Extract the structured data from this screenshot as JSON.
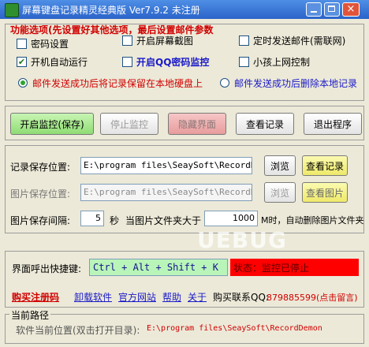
{
  "window": {
    "title": "屏幕键盘记录精灵经典版   Ver7.9.2   未注册",
    "min_glyph": "0",
    "max_glyph": "1",
    "close_glyph": "r"
  },
  "options": {
    "heading": "功能选项(先设置好其他选项，最后设置邮件参数",
    "password_settings": "密码设置",
    "screen_capture": "开启屏幕截图",
    "timed_email": "定时发送邮件(需联网)",
    "autostart": "开机自动运行",
    "qq_monitor": "开启QQ密码监控",
    "kid_control": "小孩上网控制",
    "keep_local": "邮件发送成功后将记录保留在本地硬盘上",
    "delete_local": "邮件发送成功后删除本地记录",
    "check_mark": "✔"
  },
  "actions": {
    "start": "开启监控(保存)",
    "stop": "停止监控",
    "hide": "隐藏界面",
    "view": "查看记录",
    "exit": "退出程序"
  },
  "paths": {
    "record_label": "记录保存位置:",
    "record_path": "E:\\program files\\SeaySoft\\RecordDemon",
    "browse1": "浏览",
    "view_records": "查看记录",
    "image_label": "图片保存位置:",
    "image_path": "E:\\program files\\SeaySoft\\RecordDemon",
    "browse2": "浏览",
    "view_images": "查看图片",
    "interval_label": "图片保存间隔:",
    "interval_value": "5",
    "seconds": "秒",
    "size_label": "当图片文件夹大于",
    "size_value": "1000",
    "size_suffix": "M时，自动删除图片文件夹"
  },
  "watermark": "UEBUG",
  "hotkey": {
    "label": "界面呼出快捷键:",
    "value": "Ctrl + Alt + Shift + K",
    "status": "状态：监控已停止"
  },
  "links": {
    "buy": "购买注册码",
    "uninstall": "卸载软件",
    "website": "官方网站",
    "help": "帮助",
    "about": "关于",
    "qq_label": "购买联系QQ:",
    "qq_value": "879885599(点击留言)"
  },
  "current_path": {
    "legend": "当前路径",
    "label": "软件当前位置(双击打开目录):",
    "value": "E:\\program files\\SeaySoft\\RecordDemon"
  },
  "colors": {
    "accent_red": "#d00000",
    "link_blue": "#1a1ac8",
    "status_bg": "#ff0000",
    "hotkey_bg": "#b9f5b9"
  }
}
